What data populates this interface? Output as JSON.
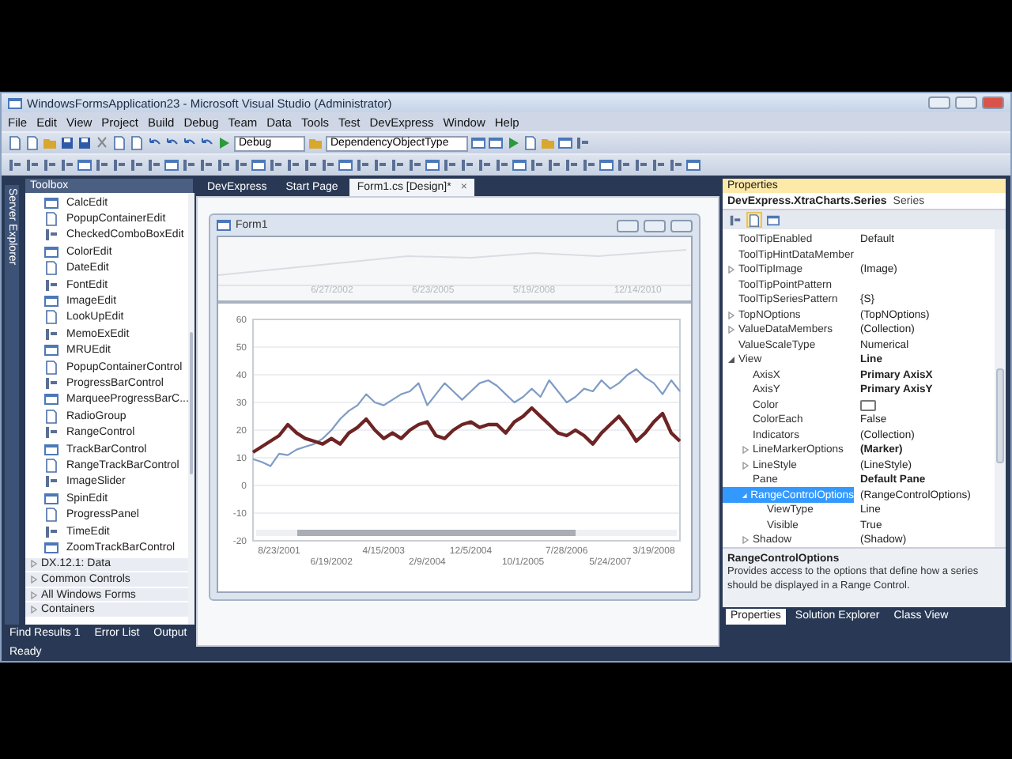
{
  "window": {
    "title": "WindowsFormsApplication23 - Microsoft Visual Studio (Administrator)"
  },
  "menu": [
    "File",
    "Edit",
    "View",
    "Project",
    "Build",
    "Debug",
    "Team",
    "Data",
    "Tools",
    "Test",
    "DevExpress",
    "Window",
    "Help"
  ],
  "toolbar": {
    "configuration": "Debug",
    "target": "DependencyObjectType"
  },
  "server_explorer": {
    "label": "Server Explorer"
  },
  "toolbox": {
    "title": "Toolbox",
    "items": [
      "CalcEdit",
      "PopupContainerEdit",
      "CheckedComboBoxEdit",
      "ColorEdit",
      "DateEdit",
      "FontEdit",
      "ImageEdit",
      "LookUpEdit",
      "MemoExEdit",
      "MRUEdit",
      "PopupContainerControl",
      "ProgressBarControl",
      "MarqueeProgressBarC...",
      "RadioGroup",
      "RangeControl",
      "TrackBarControl",
      "RangeTrackBarControl",
      "ImageSlider",
      "SpinEdit",
      "ProgressPanel",
      "TimeEdit",
      "ZoomTrackBarControl"
    ],
    "groups": [
      {
        "label": "DX.12.1: Data",
        "expanded": false
      },
      {
        "label": "Common Controls",
        "expanded": false
      },
      {
        "label": "All Windows Forms",
        "expanded": false
      },
      {
        "label": "Containers",
        "expanded": false
      }
    ]
  },
  "document_tabs": [
    {
      "label": "DevExpress",
      "selected": false
    },
    {
      "label": "Start Page",
      "selected": false
    },
    {
      "label": "Form1.cs [Design]*",
      "selected": true,
      "close": "×"
    }
  ],
  "form": {
    "title": "Form1",
    "range_control": {
      "labels": [
        "6/27/2002",
        "6/23/2005",
        "5/19/2008",
        "12/14/2010"
      ]
    },
    "chart_data": {
      "type": "line",
      "grid": true,
      "ylim": [
        -20,
        60
      ],
      "yticks": [
        -20,
        -10,
        0,
        10,
        20,
        30,
        40,
        50,
        60
      ],
      "categories": [
        null,
        null,
        null,
        "8/23/2001",
        null,
        null,
        null,
        null,
        null,
        "6/19/2002",
        null,
        null,
        null,
        null,
        null,
        "4/15/2003",
        null,
        null,
        null,
        null,
        "2/9/2004",
        null,
        null,
        null,
        null,
        "12/5/2004",
        null,
        null,
        null,
        null,
        null,
        "10/1/2005",
        null,
        null,
        null,
        null,
        "7/28/2006",
        null,
        null,
        null,
        null,
        "5/24/2007",
        null,
        null,
        null,
        null,
        "3/19/2008",
        null,
        null,
        null
      ],
      "series": [
        {
          "color": "#7f9cc4",
          "values": [
            9.5,
            8.5,
            7,
            11.5,
            11,
            13,
            14,
            15,
            17,
            20,
            24,
            27,
            29,
            33,
            30,
            29,
            31,
            33,
            34,
            37,
            29,
            33,
            37,
            34,
            31,
            34,
            37,
            38,
            36,
            33,
            30,
            32,
            35,
            32,
            38,
            34,
            30,
            32,
            35,
            34,
            38,
            35,
            37,
            40,
            42,
            39,
            37,
            33,
            38,
            34
          ]
        },
        {
          "color": "#6e2424",
          "values": [
            12,
            14,
            16,
            18,
            22,
            19,
            17,
            16,
            15,
            17,
            15,
            19,
            21,
            24,
            20,
            17,
            19,
            17,
            20,
            22,
            23,
            18,
            17,
            20,
            22,
            23,
            21,
            22,
            22,
            19,
            23,
            25,
            28,
            25,
            22,
            19,
            18,
            20,
            18,
            15,
            19,
            22,
            25,
            21,
            16,
            19,
            23,
            26,
            19,
            16
          ]
        }
      ]
    }
  },
  "properties": {
    "title": "Properties",
    "object": "DevExpress.XtraCharts.Series",
    "object_type": "Series",
    "rows": [
      {
        "name": "ToolTipEnabled",
        "value": "Default",
        "selected": false
      },
      {
        "name": "ToolTipHintDataMember",
        "selected": false
      },
      {
        "name": "ToolTipImage",
        "value": "(Image)",
        "expanded": false,
        "selected": false
      },
      {
        "name": "ToolTipPointPattern",
        "selected": false
      },
      {
        "name": "ToolTipSeriesPattern",
        "value": "{S}",
        "selected": false
      },
      {
        "name": "TopNOptions",
        "value": "(TopNOptions)",
        "expanded": false,
        "selected": false
      },
      {
        "name": "ValueDataMembers",
        "value": "(Collection)",
        "expanded": false,
        "selected": false
      },
      {
        "name": "ValueScaleType",
        "value": "Numerical",
        "selected": false
      },
      {
        "name": "View",
        "value": "Line",
        "bold": true,
        "expanded": true,
        "selected": false,
        "children": [
          {
            "name": "AxisX",
            "value": "Primary AxisX",
            "bold": true,
            "selected": false
          },
          {
            "name": "AxisY",
            "value": "Primary AxisY",
            "bold": true,
            "selected": false
          },
          {
            "name": "Color",
            "kind": "color",
            "selected": false
          },
          {
            "name": "ColorEach",
            "value": "False",
            "selected": false
          },
          {
            "name": "Indicators",
            "value": "(Collection)",
            "selected": false
          },
          {
            "name": "LineMarkerOptions",
            "value": "(Marker)",
            "bold": true,
            "expanded": false,
            "selected": false
          },
          {
            "name": "LineStyle",
            "value": "(LineStyle)",
            "expanded": false,
            "selected": false
          },
          {
            "name": "Pane",
            "value": "Default Pane",
            "bold": true,
            "selected": false
          },
          {
            "name": "RangeControlOptions",
            "value": "(RangeControlOptions)",
            "expanded": true,
            "selected": true,
            "children": [
              {
                "name": "ViewType",
                "value": "Line",
                "selected": false
              },
              {
                "name": "Visible",
                "value": "True",
                "selected": false
              }
            ]
          },
          {
            "name": "Shadow",
            "value": "(Shadow)",
            "expanded": false,
            "selected": false
          }
        ]
      }
    ],
    "description": {
      "title": "RangeControlOptions",
      "text": "Provides access to the options that define how a series should be displayed in a Range Control."
    },
    "tabs": [
      {
        "label": "Properties",
        "selected": true
      },
      {
        "label": "Solution Explorer",
        "selected": false
      },
      {
        "label": "Class View",
        "selected": false
      }
    ]
  },
  "bottom_tabs": [
    "Find Results 1",
    "Error List",
    "Output"
  ],
  "status_bar": "Ready"
}
